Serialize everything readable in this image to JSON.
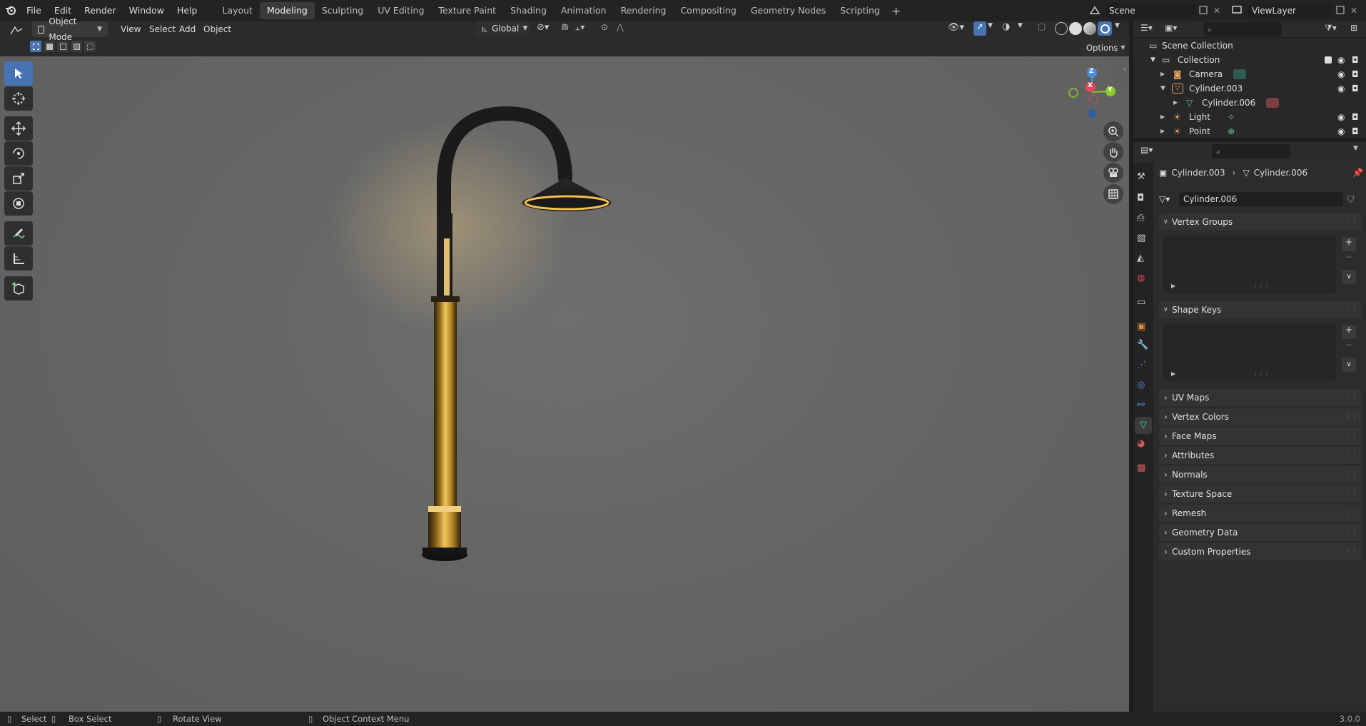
{
  "topbar": {
    "menus": [
      "File",
      "Edit",
      "Render",
      "Window",
      "Help"
    ],
    "workspaces": [
      "Layout",
      "Modeling",
      "Sculpting",
      "UV Editing",
      "Texture Paint",
      "Shading",
      "Animation",
      "Rendering",
      "Compositing",
      "Geometry Nodes",
      "Scripting"
    ],
    "active_workspace": "Modeling",
    "scene": "Scene",
    "view_layer": "ViewLayer"
  },
  "viewport_header": {
    "mode": "Object Mode",
    "menus": [
      "View",
      "Select",
      "Add",
      "Object"
    ],
    "orientation": "Global",
    "options_label": "Options"
  },
  "gizmo": {
    "z": "Z",
    "x": "X",
    "y": "Y"
  },
  "outliner": {
    "title": "Scene Collection",
    "collection": "Collection",
    "items": [
      {
        "name": "Camera",
        "icon": "camera-icon"
      },
      {
        "name": "Cylinder.003",
        "icon": "mesh-object-icon"
      },
      {
        "name": "Cylinder.006",
        "icon": "mesh-data-icon"
      },
      {
        "name": "Light",
        "icon": "light-icon"
      },
      {
        "name": "Point",
        "icon": "light-icon"
      }
    ]
  },
  "properties": {
    "breadcrumb_object": "Cylinder.003",
    "breadcrumb_data": "Cylinder.006",
    "data_name": "Cylinder.006",
    "panels": [
      "Vertex Groups",
      "Shape Keys",
      "UV Maps",
      "Vertex Colors",
      "Face Maps",
      "Attributes",
      "Normals",
      "Texture Space",
      "Remesh",
      "Geometry Data",
      "Custom Properties"
    ]
  },
  "statusbar": {
    "select": "Select",
    "box_select": "Box Select",
    "rotate_view": "Rotate View",
    "context_menu": "Object Context Menu",
    "version": "3.0.0"
  },
  "colors": {
    "accent": "#4772b3",
    "gold": "#c99a2e",
    "x_axis": "#e5475a",
    "y_axis": "#8ac926",
    "z_axis": "#4a8fe0"
  }
}
